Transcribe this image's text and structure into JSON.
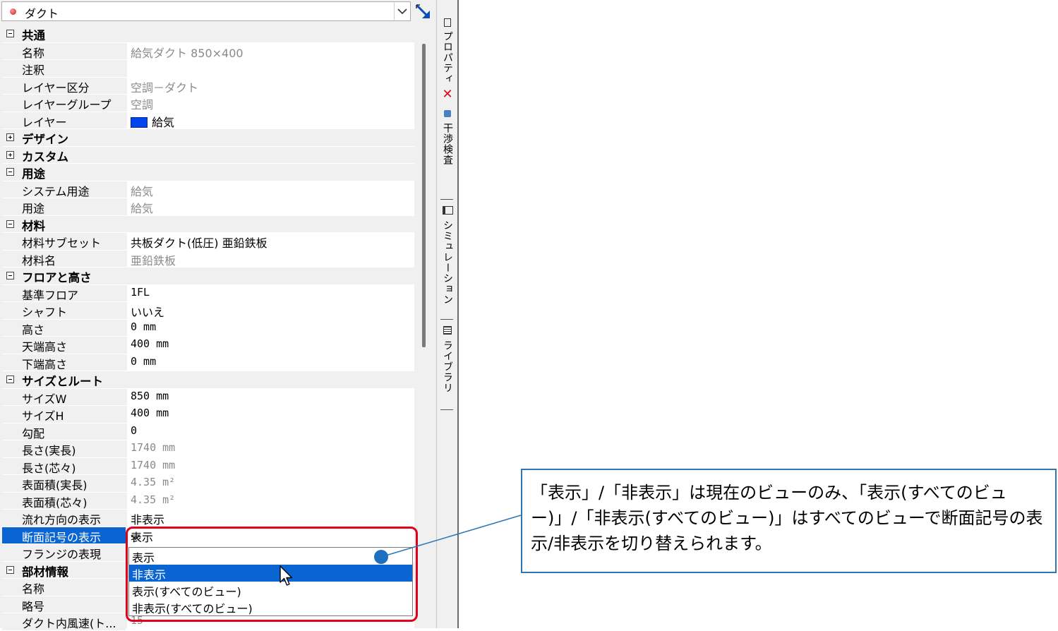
{
  "selector": {
    "value": "ダクト",
    "icon": "red-dot-icon"
  },
  "categories": [
    {
      "label": "共通",
      "expanded": true,
      "props": [
        {
          "name": "名称",
          "value": "給気ダクト 850×400",
          "dim": true
        },
        {
          "name": "注釈",
          "value": ""
        },
        {
          "name": "レイヤー区分",
          "value": "空調－ダクト",
          "dim": true
        },
        {
          "name": "レイヤーグループ",
          "value": "空調",
          "dim": true
        },
        {
          "name": "レイヤー",
          "value": "給気",
          "swatch": "#0044ee"
        }
      ]
    },
    {
      "label": "デザイン",
      "expanded": false,
      "props": []
    },
    {
      "label": "カスタム",
      "expanded": false,
      "props": []
    },
    {
      "label": "用途",
      "expanded": true,
      "props": [
        {
          "name": "システム用途",
          "value": "給気",
          "dim": true
        },
        {
          "name": "用途",
          "value": "給気",
          "dim": true
        }
      ]
    },
    {
      "label": "材料",
      "expanded": true,
      "props": [
        {
          "name": "材料サブセット",
          "value": "共板ダクト(低圧) 亜鉛鉄板"
        },
        {
          "name": "材料名",
          "value": "亜鉛鉄板",
          "dim": true
        }
      ]
    },
    {
      "label": "フロアと高さ",
      "expanded": true,
      "props": [
        {
          "name": "基準フロア",
          "value": "1FL"
        },
        {
          "name": "シャフト",
          "value": "いいえ"
        },
        {
          "name": "高さ",
          "value": "0 mm"
        },
        {
          "name": "天端高さ",
          "value": "400 mm"
        },
        {
          "name": "下端高さ",
          "value": "0 mm"
        }
      ]
    },
    {
      "label": "サイズとルート",
      "expanded": true,
      "props": [
        {
          "name": "サイズW",
          "value": "850 mm"
        },
        {
          "name": "サイズH",
          "value": "400 mm"
        },
        {
          "name": "勾配",
          "value": "0"
        },
        {
          "name": "長さ(実長)",
          "value": "1740 mm",
          "dim": true
        },
        {
          "name": "長さ(芯々)",
          "value": "1740 mm",
          "dim": true
        },
        {
          "name": "表面積(実長)",
          "value": "4.35 m²",
          "dim": true
        },
        {
          "name": "表面積(芯々)",
          "value": "4.35 m²",
          "dim": true
        },
        {
          "name": "流れ方向の表示",
          "value": "非表示"
        },
        {
          "name": "断面記号の表示",
          "value": "表示",
          "selected": true,
          "dropdown": true
        },
        {
          "name": "フランジの表現",
          "value": ""
        }
      ]
    },
    {
      "label": "部材情報",
      "expanded": true,
      "props": [
        {
          "name": "名称",
          "value": ""
        },
        {
          "name": "略号",
          "value": ""
        },
        {
          "name": "ダクト内風速(ト...",
          "value": "15",
          "dim": true
        }
      ]
    }
  ],
  "dropdown": {
    "options": [
      "表示",
      "非表示",
      "表示(すべてのビュー)",
      "非表示(すべてのビュー)"
    ],
    "highlighted_index": 1
  },
  "side_tabs": [
    {
      "label": "プロパティ",
      "icon": "property-tab-icon"
    },
    {
      "label": "干渉検査",
      "icon": "clash-check-icon"
    },
    {
      "label": "シミュレーション",
      "icon": "simulation-icon"
    },
    {
      "label": "ライブラリ",
      "icon": "library-icon"
    }
  ],
  "callout": {
    "text": "「表示」/「非表示」は現在のビューのみ、「表示(すべてのビュー)」/「非表示(すべてのビュー)」はすべてのビューで断面記号の表示/非表示を切り替えられます。"
  },
  "colors": {
    "selection": "#0a64d2",
    "annotation_red": "#e0001b",
    "callout_blue": "#2e75b6"
  }
}
